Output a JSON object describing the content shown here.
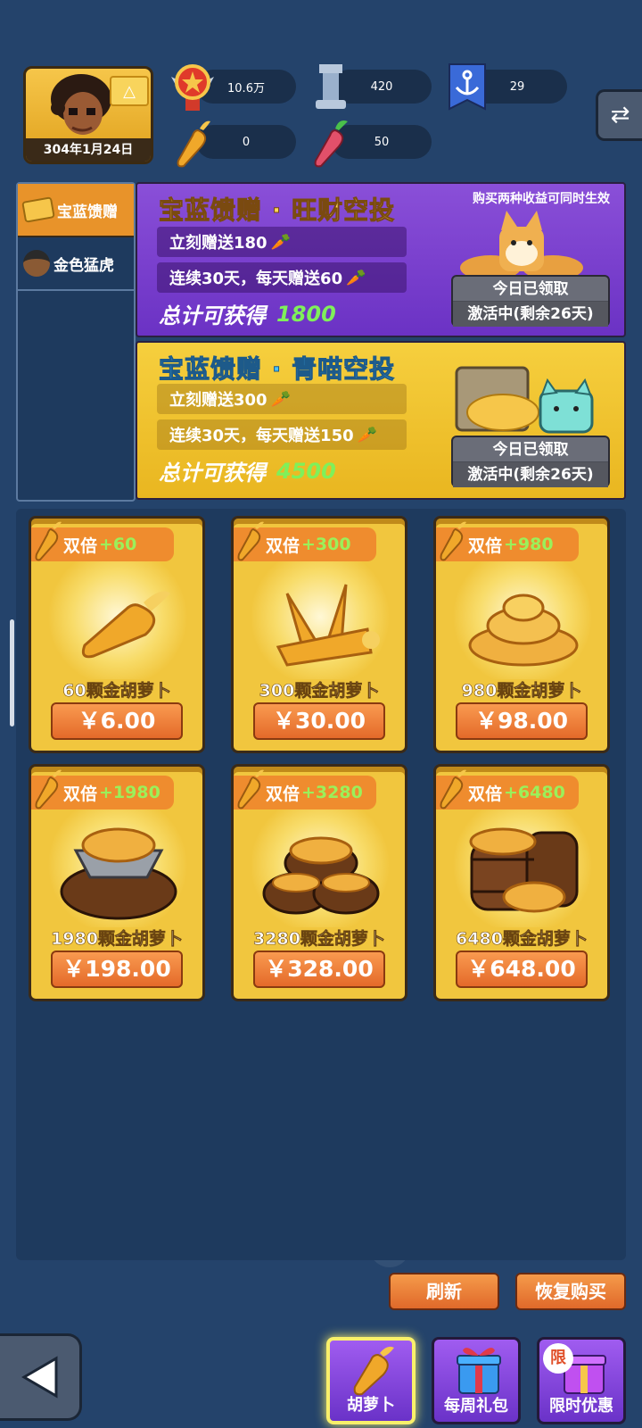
{
  "player": {
    "date": "304年1月24日",
    "rank_icon": "triangle-rank-icon"
  },
  "stats": {
    "medal": "10.6万",
    "tower": "420",
    "anchor": "29",
    "gold_carrot": "0",
    "red_carrot": "50"
  },
  "sidebar": {
    "items": [
      {
        "label": "宝蓝馈赠",
        "icon": "ticket-icon"
      },
      {
        "label": "金色猛虎",
        "icon": "pirate-icon"
      }
    ]
  },
  "promos": [
    {
      "title": "宝蓝馈赠 · 旺财空投",
      "note": "购买两种收益可同时生效",
      "instant": "立刻赠送180",
      "daily": "连续30天，每天赠送60",
      "total_label": "总计可获得",
      "total_value": "1800",
      "claim_line1": "今日已领取",
      "claim_line2": "激活中(剩余26天)",
      "color": "#7a3ecf"
    },
    {
      "title": "宝蓝馈赠 · 青喵空投",
      "instant": "立刻赠送300",
      "daily": "连续30天，每天赠送150",
      "total_label": "总计可获得",
      "total_value": "4500",
      "claim_line1": "今日已领取",
      "claim_line2": "激活中(剩余26天)",
      "color": "#f0c232"
    }
  ],
  "shop": {
    "items": [
      {
        "double_label": "双倍",
        "bonus": "+60",
        "name": "60颗金胡萝卜",
        "price": "￥6.00"
      },
      {
        "double_label": "双倍",
        "bonus": "+300",
        "name": "300颗金胡萝卜",
        "price": "￥30.00"
      },
      {
        "double_label": "双倍",
        "bonus": "+980",
        "name": "980颗金胡萝卜",
        "price": "￥98.00"
      },
      {
        "double_label": "双倍",
        "bonus": "+1980",
        "name": "1980颗金胡萝卜",
        "price": "￥198.00"
      },
      {
        "double_label": "双倍",
        "bonus": "+3280",
        "name": "3280颗金胡萝卜",
        "price": "￥328.00"
      },
      {
        "double_label": "双倍",
        "bonus": "+6480",
        "name": "6480颗金胡萝卜",
        "price": "￥648.00"
      }
    ]
  },
  "actions": {
    "refresh": "刷新",
    "restore": "恢复购买"
  },
  "bottom_nav": {
    "items": [
      {
        "label": "胡萝卜",
        "icon": "carrot-icon",
        "active": true
      },
      {
        "label": "每周礼包",
        "icon": "gift-box-icon",
        "active": false
      },
      {
        "label": "限时优惠",
        "icon": "limited-gift-icon",
        "active": false,
        "badge": "限"
      }
    ]
  },
  "colors": {
    "background": "#24436b",
    "accent_orange": "#e8932a",
    "bonus_green": "#9bf05a",
    "card_gold": "#f1c63e"
  }
}
